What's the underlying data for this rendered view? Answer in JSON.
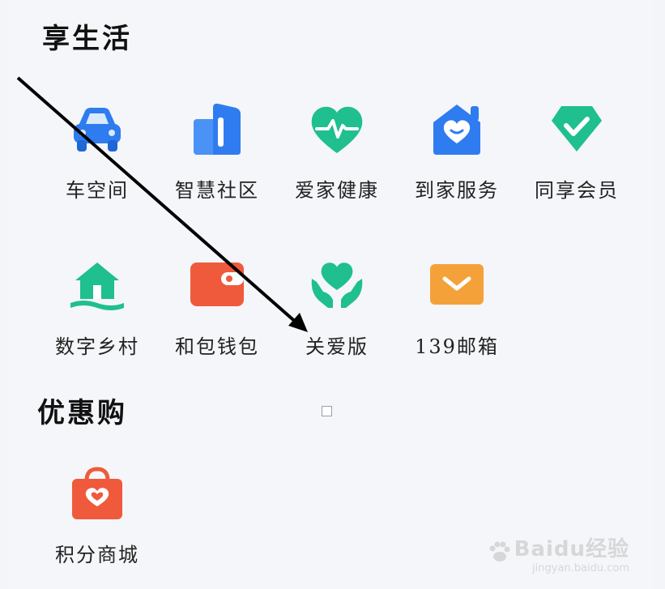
{
  "sections": [
    {
      "title": "享生活",
      "items": [
        {
          "label": "车空间",
          "icon": "car-icon",
          "color": "#2f7cf0"
        },
        {
          "label": "智慧社区",
          "icon": "community-building-icon",
          "color": "#2f7cf0"
        },
        {
          "label": "爱家健康",
          "icon": "heart-pulse-icon",
          "color": "#1fbf8f"
        },
        {
          "label": "到家服务",
          "icon": "home-heart-icon",
          "color": "#2f7cf0"
        },
        {
          "label": "同享会员",
          "icon": "membership-diamond-icon",
          "color": "#1fbf8f"
        },
        {
          "label": "数字乡村",
          "icon": "village-house-icon",
          "color": "#1fbf8f"
        },
        {
          "label": "和包钱包",
          "icon": "wallet-icon",
          "color": "#ef5a3c"
        },
        {
          "label": "关爱版",
          "icon": "care-hands-heart-icon",
          "color": "#1fbf8f"
        },
        {
          "label": "139邮箱",
          "icon": "mail-icon",
          "color": "#f5a13a"
        }
      ]
    },
    {
      "title": "优惠购",
      "items": [
        {
          "label": "积分商城",
          "icon": "points-mall-bag-icon",
          "color": "#ef5a3c"
        }
      ]
    }
  ],
  "watermark": {
    "main": "Baidu经验",
    "sub": "jingyan.baidu.com"
  }
}
